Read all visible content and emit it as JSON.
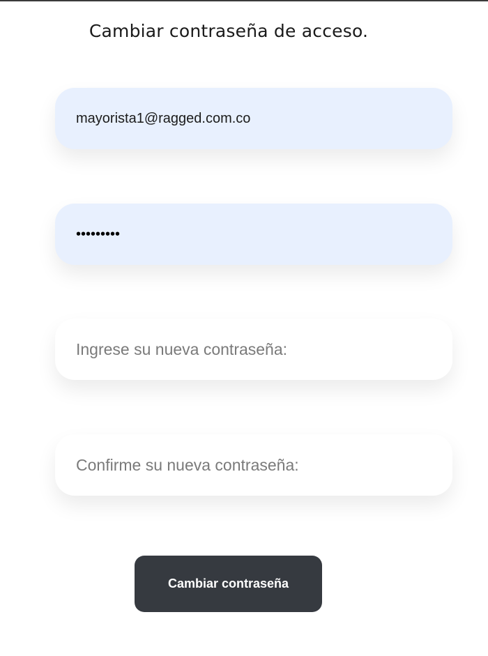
{
  "page": {
    "title": "Cambiar contraseña de acceso."
  },
  "form": {
    "email": {
      "value": "mayorista1@ragged.com.co"
    },
    "current_password": {
      "value": "•••••••••"
    },
    "new_password": {
      "value": "",
      "placeholder": "Ingrese su nueva contraseña:"
    },
    "confirm_password": {
      "value": "",
      "placeholder": "Confirme su nueva contraseña:"
    },
    "submit_label": "Cambiar contraseña"
  },
  "colors": {
    "autofill_bg": "#e8f0fe",
    "button_bg": "#363a40",
    "button_text": "#ffffff"
  }
}
